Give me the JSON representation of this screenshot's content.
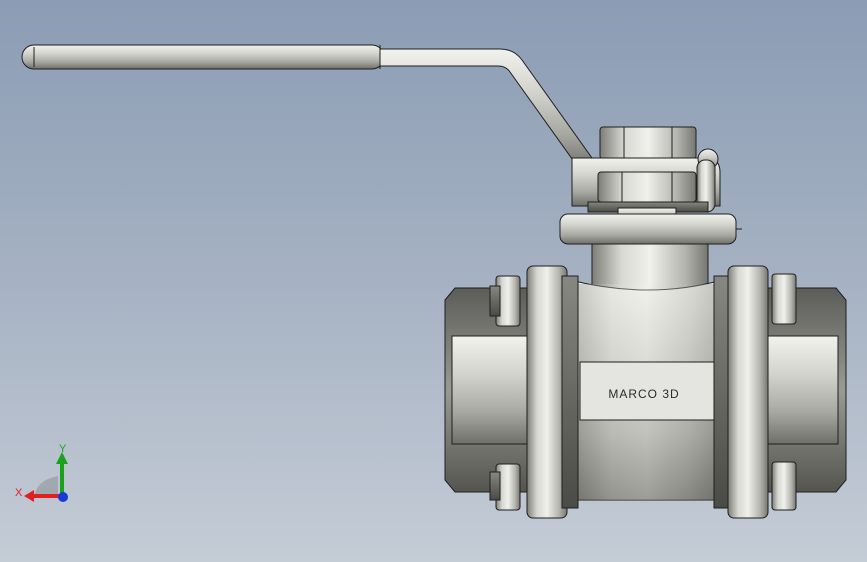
{
  "viewport": {
    "background_top": "#8b9cb4",
    "background_bottom": "#c4ccd6"
  },
  "model": {
    "engraving": "MARCO 3D",
    "metal_light": "#e6e6e2",
    "metal_mid": "#b8b8b2",
    "metal_dark": "#5a5a55",
    "edge": "#1e1e1e"
  },
  "triad": {
    "x_label": "X",
    "y_label": "Y",
    "x_color": "#e02020",
    "y_color": "#1aa31a",
    "z_color": "#1a3ad8"
  }
}
